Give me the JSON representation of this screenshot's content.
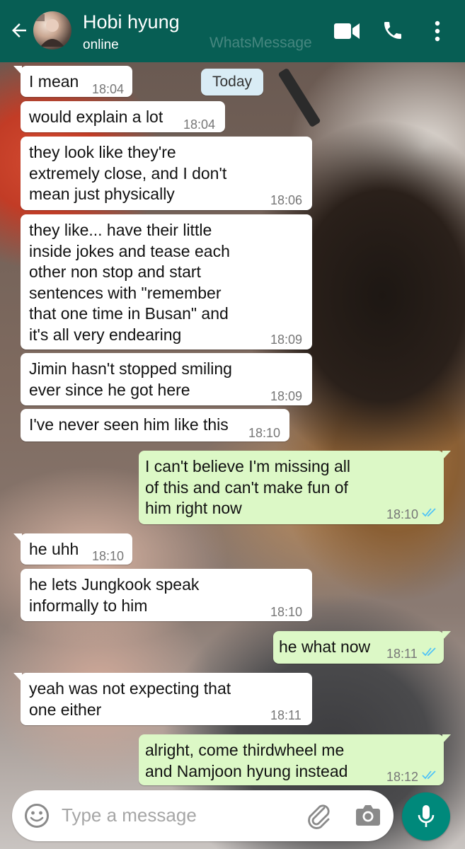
{
  "header": {
    "back_icon": "arrow-left-icon",
    "contact_name": "Hobi hyung",
    "status": "online",
    "watermark": "WhatsMessage",
    "actions": [
      "video-call-icon",
      "phone-icon",
      "more-vert-icon"
    ],
    "bg_color": "#075e54"
  },
  "date_chip": "Today",
  "messages": [
    {
      "dir": "in",
      "lines": [
        "I mean"
      ],
      "time": "18:04"
    },
    {
      "dir": "in",
      "lines": [
        "would explain a lot"
      ],
      "time": "18:04"
    },
    {
      "dir": "in",
      "lines": [
        "they look like they're",
        "extremely close, and I don't",
        "mean just physically"
      ],
      "time": "18:06"
    },
    {
      "dir": "in",
      "lines": [
        "they like... have their little",
        "inside jokes and tease each",
        "other non stop and start",
        "sentences with \"remember",
        "that one time in Busan\" and",
        "it's all very endearing"
      ],
      "time": "18:09"
    },
    {
      "dir": "in",
      "lines": [
        "Jimin hasn't stopped smiling",
        "ever since he got here"
      ],
      "time": "18:09"
    },
    {
      "dir": "in",
      "lines": [
        "I've never seen him like this"
      ],
      "time": "18:10"
    },
    {
      "dir": "out",
      "lines": [
        "I can't believe I'm missing all",
        "of this and can't make fun of",
        "him right now"
      ],
      "time": "18:10",
      "read": true
    },
    {
      "dir": "in",
      "lines": [
        "he uhh"
      ],
      "time": "18:10"
    },
    {
      "dir": "in",
      "lines": [
        "he lets Jungkook speak",
        "informally to him"
      ],
      "time": "18:10"
    },
    {
      "dir": "out",
      "lines": [
        "he what now"
      ],
      "time": "18:11",
      "read": true
    },
    {
      "dir": "in",
      "lines": [
        "yeah was not expecting that",
        "one either"
      ],
      "time": "18:11"
    },
    {
      "dir": "out",
      "lines": [
        "alright, come thirdwheel me",
        "and Namjoon hyung instead"
      ],
      "time": "18:12",
      "read": true
    }
  ],
  "composer": {
    "placeholder": "Type a message",
    "icons": [
      "emoji-icon",
      "attach-icon",
      "camera-icon",
      "mic-icon"
    ]
  },
  "colors": {
    "incoming_bubble": "#ffffff",
    "outgoing_bubble": "#dcf8c6",
    "read_ticks": "#4fc3f7",
    "mic_button": "#00897b",
    "date_chip": "#d9ecf5"
  }
}
